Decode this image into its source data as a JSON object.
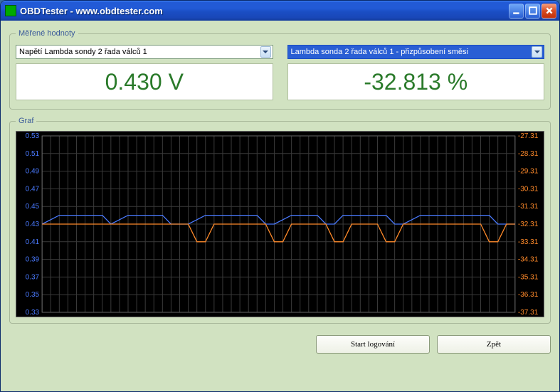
{
  "window": {
    "title": "OBDTester - www.obdtester.com"
  },
  "measured": {
    "legend": "Měřené hodnoty",
    "left": {
      "dropdown": "Napětí Lambda sondy 2 řada válců 1",
      "value": "0.430 V"
    },
    "right": {
      "dropdown": "Lambda sonda 2 řada válců 1 - přizpůsobení směsi",
      "value": "-32.813 %"
    }
  },
  "graph": {
    "legend": "Graf"
  },
  "buttons": {
    "start_log": "Start logování",
    "back": "Zpět"
  },
  "chart_data": {
    "type": "line",
    "x_range": [
      0,
      55
    ],
    "left_axis": {
      "color": "#4a7aff",
      "ticks": [
        0.33,
        0.35,
        0.37,
        0.39,
        0.41,
        0.43,
        0.45,
        0.47,
        0.49,
        0.51,
        0.53
      ],
      "range": [
        0.33,
        0.53
      ]
    },
    "right_axis": {
      "color": "#ff8a2a",
      "ticks": [
        -37.31,
        -36.31,
        -35.31,
        -34.31,
        -33.31,
        -32.31,
        -31.31,
        -30.31,
        -29.31,
        -28.31,
        -27.31
      ],
      "range": [
        -37.31,
        -27.31
      ]
    },
    "series": [
      {
        "name": "Napětí Lambda sondy 2 řada válců 1",
        "axis": "left",
        "color": "#4a7aff",
        "x": [
          0,
          1,
          2,
          3,
          4,
          5,
          6,
          7,
          8,
          9,
          10,
          11,
          12,
          13,
          14,
          15,
          16,
          17,
          18,
          19,
          20,
          21,
          22,
          23,
          24,
          25,
          26,
          27,
          28,
          29,
          30,
          31,
          32,
          33,
          34,
          35,
          36,
          37,
          38,
          39,
          40,
          41,
          42,
          43,
          44,
          45,
          46,
          47,
          48,
          49,
          50,
          51,
          52,
          53,
          54,
          55
        ],
        "y": [
          0.43,
          0.435,
          0.44,
          0.44,
          0.44,
          0.44,
          0.44,
          0.44,
          0.43,
          0.435,
          0.44,
          0.44,
          0.44,
          0.44,
          0.44,
          0.43,
          0.43,
          0.43,
          0.435,
          0.44,
          0.44,
          0.44,
          0.44,
          0.44,
          0.44,
          0.44,
          0.43,
          0.43,
          0.435,
          0.44,
          0.44,
          0.44,
          0.44,
          0.43,
          0.43,
          0.44,
          0.44,
          0.44,
          0.44,
          0.44,
          0.44,
          0.43,
          0.43,
          0.435,
          0.44,
          0.44,
          0.44,
          0.44,
          0.44,
          0.44,
          0.44,
          0.44,
          0.44,
          0.43,
          0.43,
          0.43
        ]
      },
      {
        "name": "Lambda sonda 2 řada válců 1 - přizpůsobení směsi",
        "axis": "right",
        "color": "#ff8a2a",
        "x": [
          0,
          1,
          2,
          3,
          4,
          5,
          6,
          7,
          8,
          9,
          10,
          11,
          12,
          13,
          14,
          15,
          16,
          17,
          18,
          19,
          20,
          21,
          22,
          23,
          24,
          25,
          26,
          27,
          28,
          29,
          30,
          31,
          32,
          33,
          34,
          35,
          36,
          37,
          38,
          39,
          40,
          41,
          42,
          43,
          44,
          45,
          46,
          47,
          48,
          49,
          50,
          51,
          52,
          53,
          54,
          55
        ],
        "y": [
          -32.31,
          -32.31,
          -32.31,
          -32.31,
          -32.31,
          -32.31,
          -32.31,
          -32.31,
          -32.31,
          -32.31,
          -32.31,
          -32.31,
          -32.31,
          -32.31,
          -32.31,
          -32.31,
          -32.31,
          -32.31,
          -33.31,
          -33.31,
          -32.31,
          -32.31,
          -32.31,
          -32.31,
          -32.31,
          -32.31,
          -32.31,
          -33.31,
          -33.31,
          -32.31,
          -32.31,
          -32.31,
          -32.31,
          -32.31,
          -33.31,
          -33.31,
          -32.31,
          -32.31,
          -32.31,
          -32.31,
          -33.31,
          -33.31,
          -32.31,
          -32.31,
          -32.31,
          -32.31,
          -32.31,
          -32.31,
          -32.31,
          -32.31,
          -32.31,
          -32.31,
          -33.31,
          -33.31,
          -32.31,
          -32.31
        ]
      }
    ]
  }
}
